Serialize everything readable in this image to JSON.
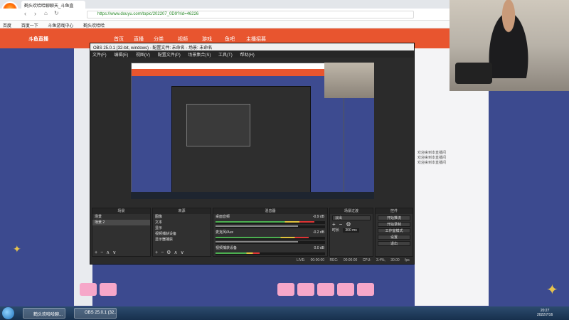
{
  "browser": {
    "tab_title": "鹤头欢哈哈聊聊天_斗鱼直",
    "url": "https://www.douyu.com/topic/202207_0D9?rid=46226",
    "bookmarks": [
      "百度",
      "百度一下",
      "斗鱼游戏中心",
      "鹤头欢哈哈"
    ]
  },
  "douyu": {
    "logo_text": "斗鱼直播",
    "nav": [
      "首页",
      "直播",
      "分类",
      "视频",
      "游戏",
      "鱼吧",
      "主播招募"
    ],
    "chat_lines": [
      "欢迎来到本直播间",
      "欢迎来到本直播间",
      "欢迎来到本直播间"
    ]
  },
  "obs": {
    "title": "OBS 25.0.1 (32-bit, windows) - 配置文件: 未命名 - 场景: 未命名",
    "menu": [
      "文件(F)",
      "编辑(E)",
      "视图(V)",
      "配置文件(P)",
      "场景集合(S)",
      "工具(T)",
      "帮助(H)"
    ],
    "scenes_header": "场景",
    "scenes": [
      "场景",
      "场景 2"
    ],
    "sources_header": "来源",
    "sources": [
      "图像",
      "文本",
      "显示",
      "视频捕获设备",
      "显示器捕获"
    ],
    "mixer_header": "混音器",
    "mixer": [
      {
        "label": "桌面音频",
        "level": "-0.9 dB"
      },
      {
        "label": "麦克风/Aux",
        "level": "-0.2 dB"
      },
      {
        "label": "视频捕获设备",
        "level": "0.0 dB"
      }
    ],
    "transitions_header": "场景过渡",
    "transition_value": "淡出",
    "duration_label": "时长",
    "duration_value": "300 ms",
    "controls_header": "控件",
    "controls": [
      "开始推流",
      "开始录制",
      "工作室模式",
      "设置",
      "退出"
    ],
    "status": [
      "LIVE: 00:00:00",
      "REC: 00:00:00",
      "CPU: 3.4%, 30.00 fps"
    ]
  },
  "taskbar": {
    "items": [
      "鹤头欢哈哈聊...",
      "OBS 25.0.1 (32..."
    ],
    "time": "20:27",
    "date": "2022/7/16"
  }
}
